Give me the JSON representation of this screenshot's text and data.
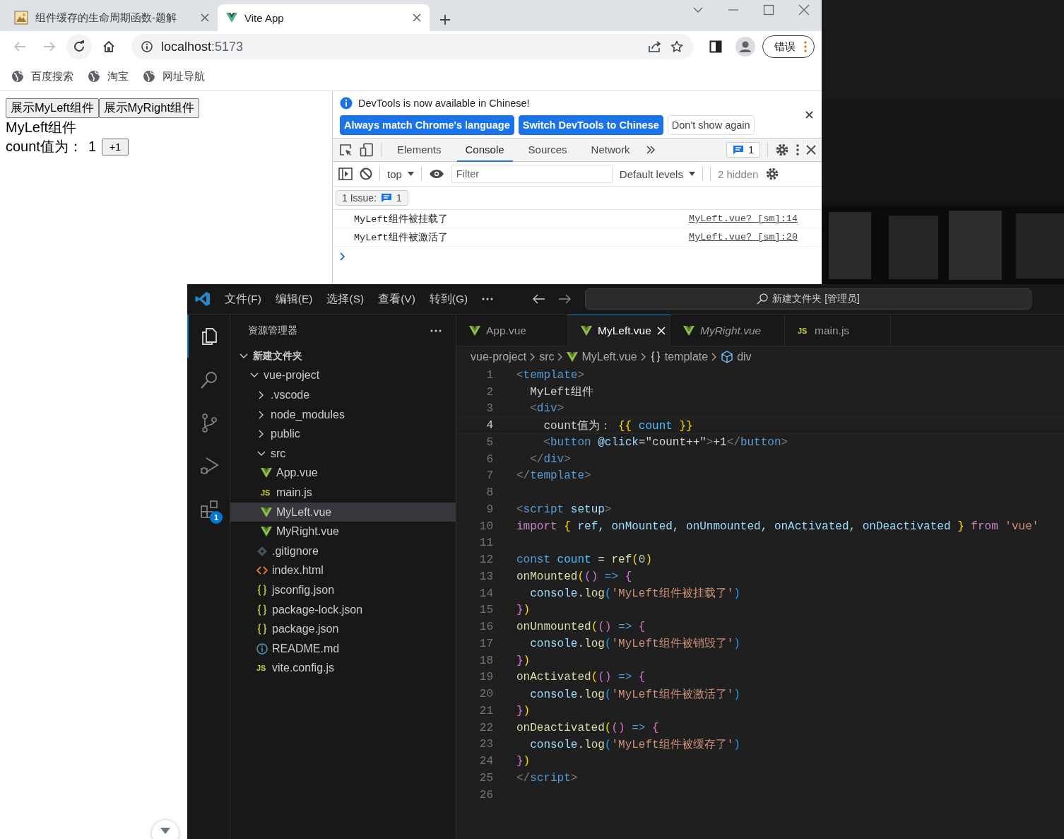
{
  "browser": {
    "tabs": [
      {
        "title": "组件缓存的生命周期函数-题解",
        "kind": "site",
        "selected": false
      },
      {
        "title": "Vite App",
        "kind": "vue",
        "selected": true
      }
    ],
    "address": {
      "host": "localhost",
      "port": ":5173"
    },
    "profile_button": "错误",
    "bookmarks": [
      "百度搜索",
      "淘宝",
      "网址导航"
    ],
    "page": {
      "buttons": [
        "展示MyLeft组件",
        "展示MyRight组件"
      ],
      "heading": "MyLeft组件",
      "count_label": "count值为：",
      "count_value": "1",
      "increment_button": "+1"
    }
  },
  "devtools": {
    "banner": {
      "message": "DevTools is now available in Chinese!",
      "buttons": [
        {
          "label": "Always match Chrome's language",
          "kind": "primary"
        },
        {
          "label": "Switch DevTools to Chinese",
          "kind": "primary"
        },
        {
          "label": "Don't show again",
          "kind": "secondary"
        }
      ]
    },
    "tabs": [
      {
        "label": "Elements",
        "selected": false
      },
      {
        "label": "Console",
        "selected": true
      },
      {
        "label": "Sources",
        "selected": false
      },
      {
        "label": "Network",
        "selected": false
      }
    ],
    "issues_count": "1",
    "context": "top",
    "filter": {
      "placeholder": "Filter"
    },
    "levels": "Default levels",
    "hidden": "2 hidden",
    "issue_label": "1 Issue:",
    "issue_count": "1",
    "messages": [
      {
        "text": "MyLeft组件被挂载了",
        "source": "MyLeft.vue? [sm]:14"
      },
      {
        "text": "MyLeft组件被激活了",
        "source": "MyLeft.vue? [sm]:20"
      }
    ]
  },
  "editor": {
    "menu": [
      "文件(F)",
      "编辑(E)",
      "选择(S)",
      "查看(V)",
      "转到(G)"
    ],
    "search": "新建文件夹 [管理员]",
    "activity": [
      {
        "kind": "explorer",
        "selected": true
      },
      {
        "kind": "search",
        "selected": false
      },
      {
        "kind": "source-control",
        "selected": false
      },
      {
        "kind": "run",
        "selected": false
      },
      {
        "kind": "extensions",
        "selected": false,
        "badge": "1"
      }
    ],
    "explorer": {
      "title": "资源管理器",
      "tree": [
        {
          "name": "新建文件夹",
          "kind": "root",
          "expanded": true,
          "selected": false,
          "children": [
            {
              "name": "vue-project",
              "kind": "folder",
              "expanded": true,
              "selected": false,
              "children": [
                {
                  "name": ".vscode",
                  "kind": "folder",
                  "expanded": false,
                  "selected": false
                },
                {
                  "name": "node_modules",
                  "kind": "folder",
                  "expanded": false,
                  "selected": false
                },
                {
                  "name": "public",
                  "kind": "folder",
                  "expanded": false,
                  "selected": false
                },
                {
                  "name": "src",
                  "kind": "folder",
                  "expanded": true,
                  "selected": false,
                  "children": [
                    {
                      "name": "App.vue",
                      "kind": "vue",
                      "selected": false
                    },
                    {
                      "name": "main.js",
                      "kind": "js",
                      "icon": "JS",
                      "selected": false
                    },
                    {
                      "name": "MyLeft.vue",
                      "kind": "vue",
                      "selected": true
                    },
                    {
                      "name": "MyRight.vue",
                      "kind": "vue",
                      "selected": false
                    }
                  ]
                },
                {
                  "name": ".gitignore",
                  "kind": "git",
                  "selected": false
                },
                {
                  "name": "index.html",
                  "kind": "html",
                  "selected": false
                },
                {
                  "name": "jsconfig.json",
                  "kind": "json",
                  "selected": false
                },
                {
                  "name": "package-lock.json",
                  "kind": "json",
                  "selected": false
                },
                {
                  "name": "package.json",
                  "kind": "json",
                  "selected": false
                },
                {
                  "name": "README.md",
                  "kind": "info",
                  "selected": false
                },
                {
                  "name": "vite.config.js",
                  "kind": "js",
                  "icon": "JS",
                  "selected": false
                }
              ]
            }
          ]
        }
      ]
    },
    "tabs": [
      {
        "label": "App.vue",
        "kind": "vue",
        "selected": false,
        "preview": false
      },
      {
        "label": "MyLeft.vue",
        "kind": "vue",
        "selected": true,
        "preview": false
      },
      {
        "label": "MyRight.vue",
        "kind": "vue",
        "selected": false,
        "preview": true
      },
      {
        "label": "main.js",
        "kind": "js",
        "icon": "JS",
        "selected": false,
        "preview": false
      }
    ],
    "breadcrumbs": [
      {
        "label": "vue-project",
        "kind": "folder"
      },
      {
        "label": "src",
        "kind": "folder"
      },
      {
        "label": "MyLeft.vue",
        "kind": "vue"
      },
      {
        "label": "template",
        "kind": "braces"
      },
      {
        "label": "div",
        "kind": "element"
      }
    ],
    "lines": [
      {
        "number": "1",
        "current": false,
        "tokens": [
          {
            "text": "<",
            "kind": "punct"
          },
          {
            "text": "template",
            "kind": "tag"
          },
          {
            "text": ">",
            "kind": "punct"
          }
        ]
      },
      {
        "number": "2",
        "current": false,
        "tokens": [
          {
            "text": "  MyLeft组件",
            "kind": "text"
          }
        ]
      },
      {
        "number": "3",
        "current": false,
        "tokens": [
          {
            "text": "  <",
            "kind": "punct"
          },
          {
            "text": "div",
            "kind": "tag"
          },
          {
            "text": ">",
            "kind": "punct"
          }
        ]
      },
      {
        "number": "4",
        "current": true,
        "tokens": [
          {
            "text": "    count值为： ",
            "kind": "text"
          },
          {
            "text": "{{",
            "kind": "b1"
          },
          {
            "text": " count ",
            "kind": "var"
          },
          {
            "text": "}}",
            "kind": "b1"
          }
        ]
      },
      {
        "number": "5",
        "current": false,
        "tokens": [
          {
            "text": "    <",
            "kind": "punct"
          },
          {
            "text": "button",
            "kind": "tag"
          },
          {
            "text": " @click",
            "kind": "attr"
          },
          {
            "text": "=\"count++\"",
            "kind": "text"
          },
          {
            "text": ">",
            "kind": "punct"
          },
          {
            "text": "+1",
            "kind": "text"
          },
          {
            "text": "</",
            "kind": "punct"
          },
          {
            "text": "button",
            "kind": "tag"
          },
          {
            "text": ">",
            "kind": "punct"
          }
        ]
      },
      {
        "number": "6",
        "current": false,
        "tokens": [
          {
            "text": "  </",
            "kind": "punct"
          },
          {
            "text": "div",
            "kind": "tag"
          },
          {
            "text": ">",
            "kind": "punct"
          }
        ]
      },
      {
        "number": "7",
        "current": false,
        "tokens": [
          {
            "text": "</",
            "kind": "punct"
          },
          {
            "text": "template",
            "kind": "tag"
          },
          {
            "text": ">",
            "kind": "punct"
          }
        ]
      },
      {
        "number": "8",
        "current": false
      },
      {
        "number": "9",
        "current": false,
        "tokens": [
          {
            "text": "<",
            "kind": "punct"
          },
          {
            "text": "script",
            "kind": "tag"
          },
          {
            "text": " setup",
            "kind": "attr"
          },
          {
            "text": ">",
            "kind": "punct"
          }
        ]
      },
      {
        "number": "10",
        "current": false,
        "tokens": [
          {
            "text": "import ",
            "kind": "control"
          },
          {
            "text": "{",
            "kind": "b1"
          },
          {
            "text": " ref, onMounted, onUnmounted, onActivated, onDeactivated ",
            "kind": "attr"
          },
          {
            "text": "}",
            "kind": "b1"
          },
          {
            "text": " from ",
            "kind": "control"
          },
          {
            "text": "'vue'",
            "kind": "string"
          }
        ]
      },
      {
        "number": "11",
        "current": false
      },
      {
        "number": "12",
        "current": false,
        "tokens": [
          {
            "text": "const",
            "kind": "keyword"
          },
          {
            "text": " count",
            "kind": "var"
          },
          {
            "text": " = ",
            "kind": "text"
          },
          {
            "text": "ref",
            "kind": "func"
          },
          {
            "text": "(",
            "kind": "b1"
          },
          {
            "text": "0",
            "kind": "num"
          },
          {
            "text": ")",
            "kind": "b1"
          }
        ]
      },
      {
        "number": "13",
        "current": false,
        "tokens": [
          {
            "text": "onMounted",
            "kind": "func"
          },
          {
            "text": "(",
            "kind": "b1"
          },
          {
            "text": "()",
            "kind": "b2"
          },
          {
            "text": " => ",
            "kind": "keyword"
          },
          {
            "text": "{",
            "kind": "b2"
          }
        ]
      },
      {
        "number": "14",
        "current": false,
        "tokens": [
          {
            "text": "  console",
            "kind": "attr"
          },
          {
            "text": ".",
            "kind": "text"
          },
          {
            "text": "log",
            "kind": "func"
          },
          {
            "text": "(",
            "kind": "b3"
          },
          {
            "text": "'MyLeft组件被挂载了'",
            "kind": "string"
          },
          {
            "text": ")",
            "kind": "b3"
          }
        ]
      },
      {
        "number": "15",
        "current": false,
        "tokens": [
          {
            "text": "}",
            "kind": "b2"
          },
          {
            "text": ")",
            "kind": "b1"
          }
        ]
      },
      {
        "number": "16",
        "current": false,
        "tokens": [
          {
            "text": "onUnmounted",
            "kind": "func"
          },
          {
            "text": "(",
            "kind": "b1"
          },
          {
            "text": "()",
            "kind": "b2"
          },
          {
            "text": " => ",
            "kind": "keyword"
          },
          {
            "text": "{",
            "kind": "b2"
          }
        ]
      },
      {
        "number": "17",
        "current": false,
        "tokens": [
          {
            "text": "  console",
            "kind": "attr"
          },
          {
            "text": ".",
            "kind": "text"
          },
          {
            "text": "log",
            "kind": "func"
          },
          {
            "text": "(",
            "kind": "b3"
          },
          {
            "text": "'MyLeft组件被销毁了'",
            "kind": "string"
          },
          {
            "text": ")",
            "kind": "b3"
          }
        ]
      },
      {
        "number": "18",
        "current": false,
        "tokens": [
          {
            "text": "}",
            "kind": "b2"
          },
          {
            "text": ")",
            "kind": "b1"
          }
        ]
      },
      {
        "number": "19",
        "current": false,
        "tokens": [
          {
            "text": "onActivated",
            "kind": "func"
          },
          {
            "text": "(",
            "kind": "b1"
          },
          {
            "text": "()",
            "kind": "b2"
          },
          {
            "text": " => ",
            "kind": "keyword"
          },
          {
            "text": "{",
            "kind": "b2"
          }
        ]
      },
      {
        "number": "20",
        "current": false,
        "tokens": [
          {
            "text": "  console",
            "kind": "attr"
          },
          {
            "text": ".",
            "kind": "text"
          },
          {
            "text": "log",
            "kind": "func"
          },
          {
            "text": "(",
            "kind": "b3"
          },
          {
            "text": "'MyLeft组件被激活了'",
            "kind": "string"
          },
          {
            "text": ")",
            "kind": "b3"
          }
        ]
      },
      {
        "number": "21",
        "current": false,
        "tokens": [
          {
            "text": "}",
            "kind": "b2"
          },
          {
            "text": ")",
            "kind": "b1"
          }
        ]
      },
      {
        "number": "22",
        "current": false,
        "tokens": [
          {
            "text": "onDeactivated",
            "kind": "func"
          },
          {
            "text": "(",
            "kind": "b1"
          },
          {
            "text": "()",
            "kind": "b2"
          },
          {
            "text": " => ",
            "kind": "keyword"
          },
          {
            "text": "{",
            "kind": "b2"
          }
        ]
      },
      {
        "number": "23",
        "current": false,
        "tokens": [
          {
            "text": "  console",
            "kind": "attr"
          },
          {
            "text": ".",
            "kind": "text"
          },
          {
            "text": "log",
            "kind": "func"
          },
          {
            "text": "(",
            "kind": "b3"
          },
          {
            "text": "'MyLeft组件被缓存了'",
            "kind": "string"
          },
          {
            "text": ")",
            "kind": "b3"
          }
        ]
      },
      {
        "number": "24",
        "current": false,
        "tokens": [
          {
            "text": "}",
            "kind": "b2"
          },
          {
            "text": ")",
            "kind": "b1"
          }
        ]
      },
      {
        "number": "25",
        "current": false,
        "tokens": [
          {
            "text": "</",
            "kind": "punct"
          },
          {
            "text": "script",
            "kind": "tag"
          },
          {
            "text": ">",
            "kind": "punct"
          }
        ]
      },
      {
        "number": "26",
        "current": false
      }
    ]
  }
}
